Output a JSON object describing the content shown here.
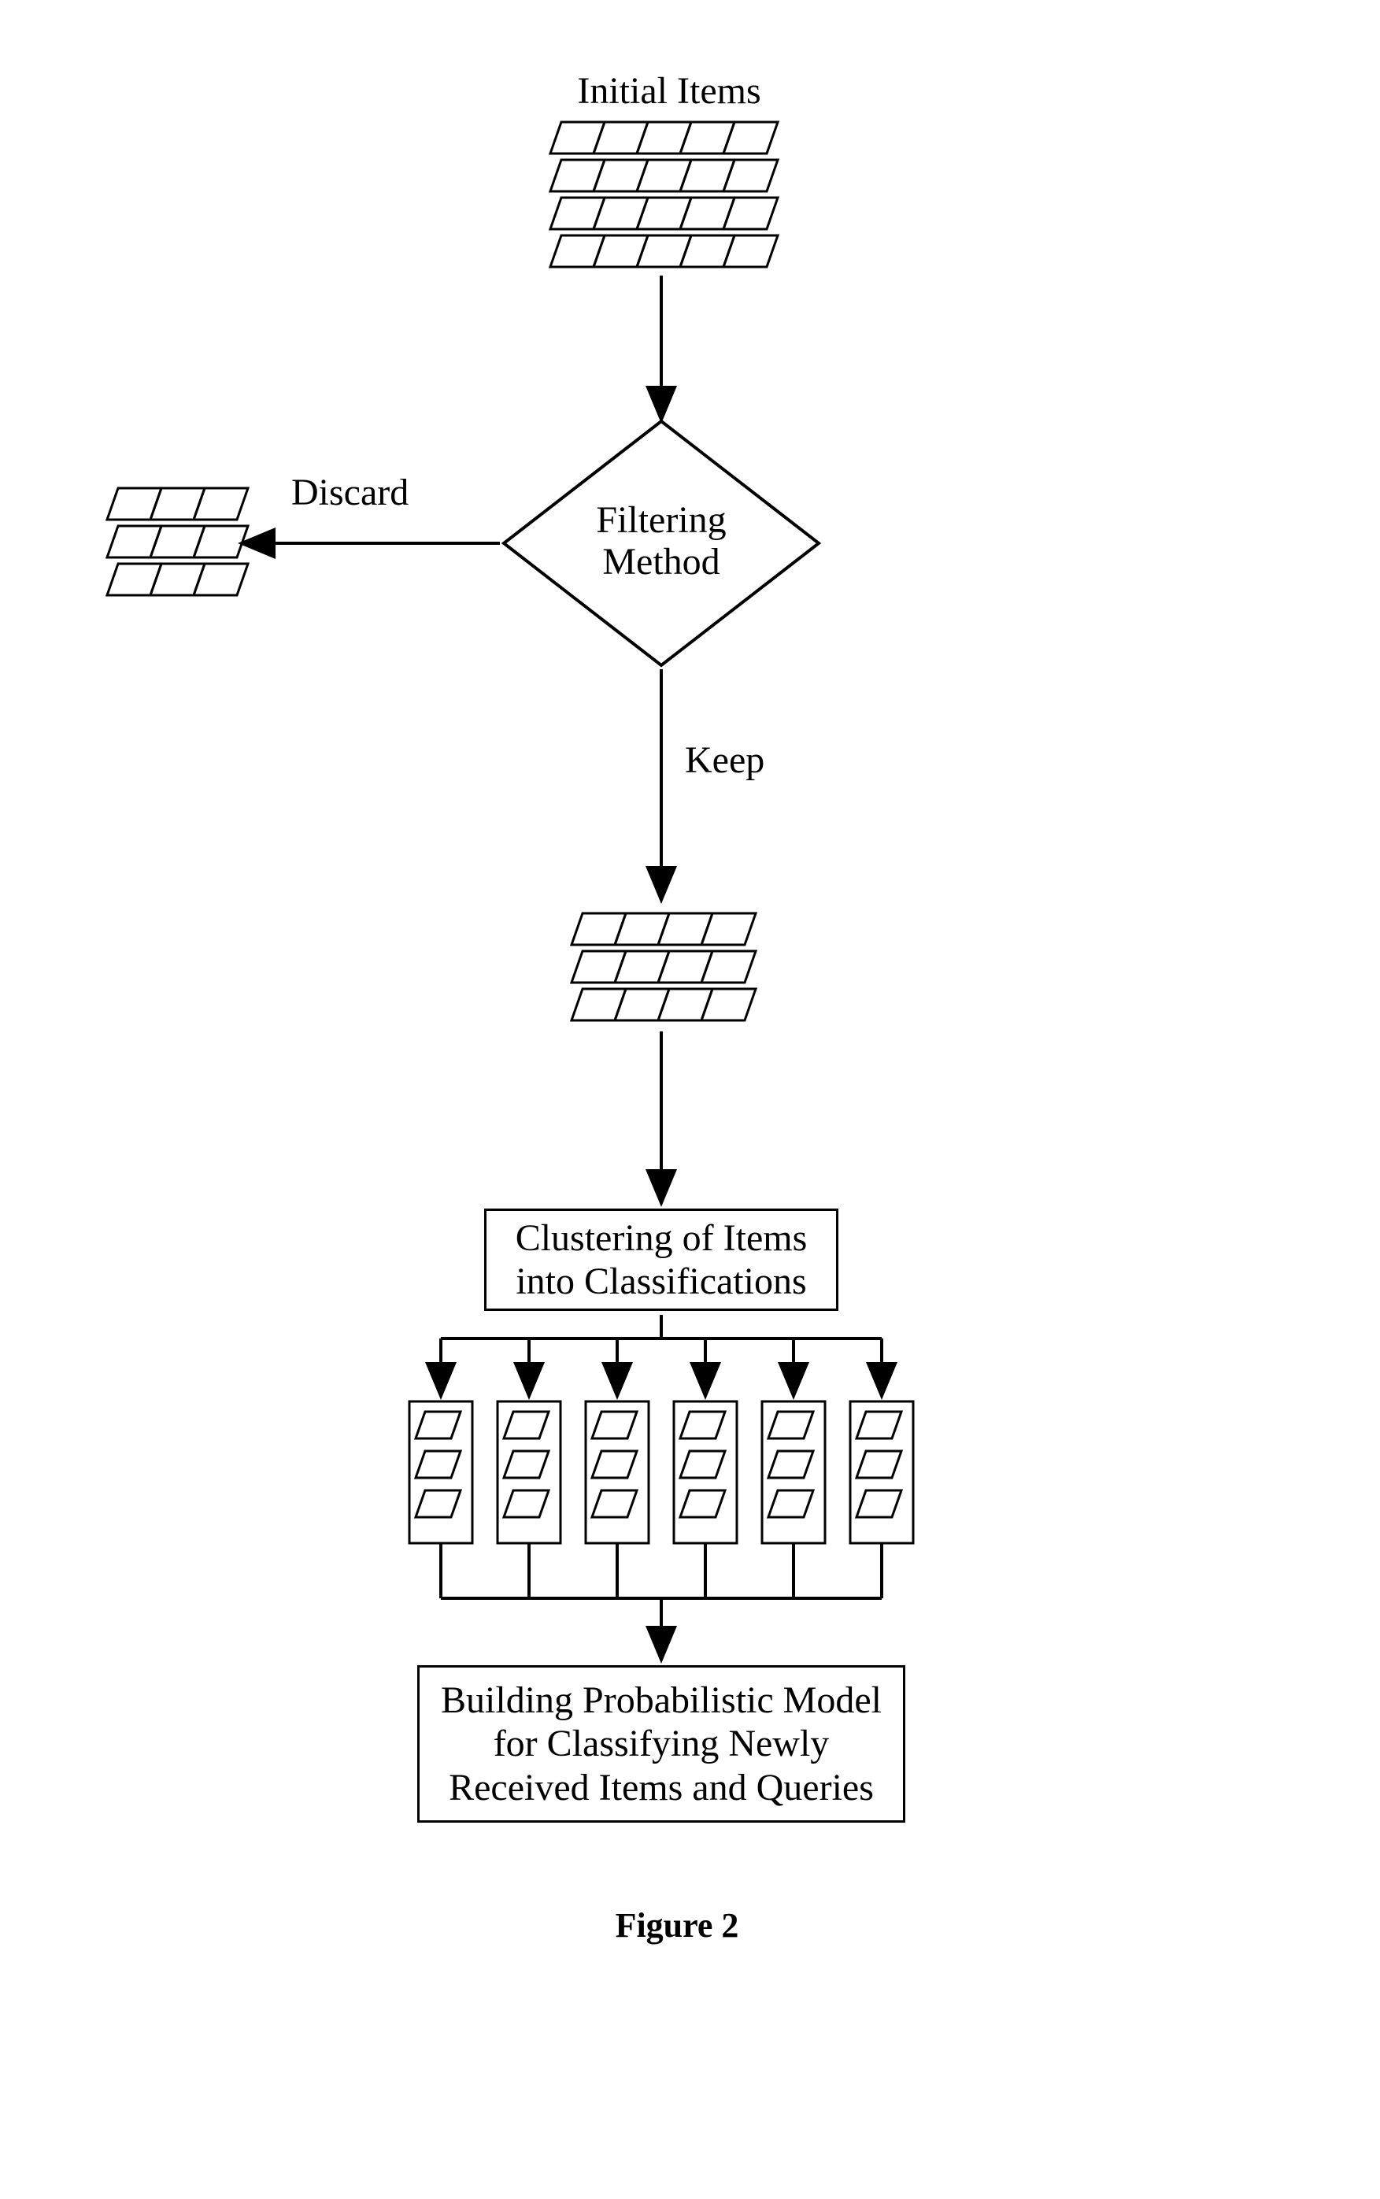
{
  "labels": {
    "initialItems": "Initial Items",
    "discard": "Discard",
    "filteringMethod1": "Filtering",
    "filteringMethod2": "Method",
    "keep": "Keep",
    "clustering1": "Clustering of Items",
    "clustering2": "into Classifications",
    "building1": "Building Probabilistic Model",
    "building2": "for Classifying Newly",
    "building3": "Received Items and Queries"
  },
  "caption": "Figure 2"
}
